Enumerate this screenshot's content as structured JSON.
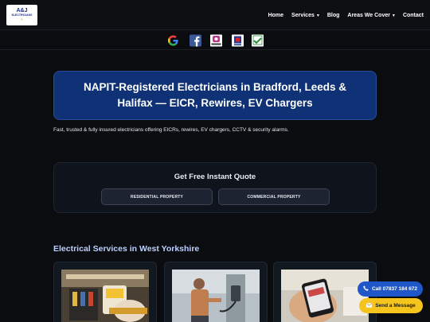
{
  "header": {
    "logo": {
      "line1": "A&J",
      "line2": "ELECTRICIANS"
    },
    "nav": [
      {
        "label": "Home",
        "caret": ""
      },
      {
        "label": "Services",
        "caret": "▾"
      },
      {
        "label": "Blog",
        "caret": ""
      },
      {
        "label": "Areas We Cover",
        "caret": "▾"
      },
      {
        "label": "Contact",
        "caret": ""
      }
    ]
  },
  "social_icons": [
    "google-icon",
    "facebook-icon",
    "instagram-icon",
    "checkatrade-icon",
    "napit-icon"
  ],
  "hero": {
    "title": "NAPIT-Registered Electricians in Bradford, Leeds & Halifax — EICR, Rewires, EV Chargers"
  },
  "tagline": "Fast, trusted & fully insured electricians offering EICRs, rewires, EV chargers, CCTV & security alarms.",
  "quote": {
    "title": "Get Free Instant Quote",
    "residential_label": "RESIDENTIAL PROPERTY",
    "commercial_label": "COMMERCIAL PROPERTY"
  },
  "services": {
    "title": "Electrical Services in West Yorkshire"
  },
  "floating": {
    "call_label": "Call 07837 184 672",
    "message_label": "Send a Message"
  },
  "colors": {
    "background": "#0b0c10",
    "hero": "#0f3277",
    "call": "#1f57c8",
    "message": "#f5c51e",
    "services_title": "#bcd0ff"
  }
}
